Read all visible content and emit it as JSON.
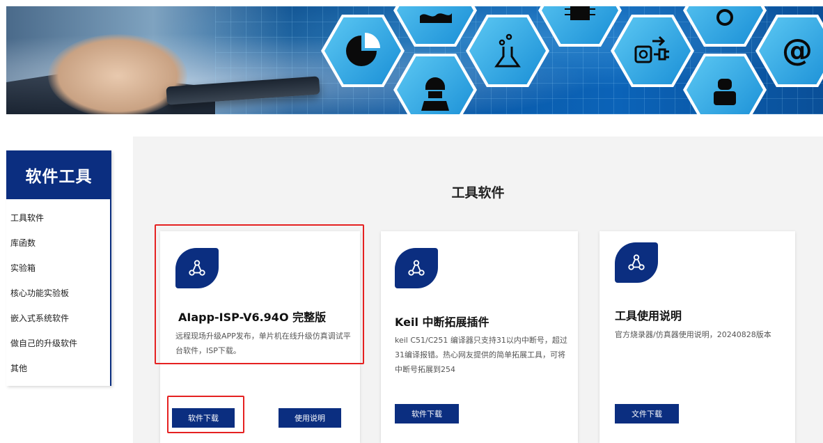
{
  "sidebar": {
    "title": "软件工具",
    "items": [
      {
        "label": "工具软件"
      },
      {
        "label": "库函数"
      },
      {
        "label": "实验箱"
      },
      {
        "label": "核心功能实验板"
      },
      {
        "label": "嵌入式系统软件"
      },
      {
        "label": "做自己的升级软件"
      },
      {
        "label": "其他"
      }
    ]
  },
  "main": {
    "title": "工具软件",
    "cards": [
      {
        "icon": "share-nodes-icon",
        "title": "AIapp-ISP-V6.94O 完整版",
        "description": "远程现场升级APP发布，单片机在线升级仿真调试平台软件，ISP下载。",
        "buttons": [
          "软件下载",
          "使用说明"
        ]
      },
      {
        "icon": "share-nodes-icon",
        "title": "Keil 中断拓展插件",
        "description": "keil C51/C251 编译器只支持31以内中断号，超过31编译报错。热心网友提供的简单拓展工具，可将中断号拓展到254",
        "buttons": [
          "软件下载"
        ]
      },
      {
        "icon": "share-nodes-icon",
        "title": "工具使用说明",
        "description": "官方烧录器/仿真器使用说明，20240828版本",
        "buttons": [
          "文件下载"
        ]
      }
    ]
  },
  "colors": {
    "primary": "#0b2e80",
    "highlight": "#e52121",
    "background": "#f3f3f3"
  }
}
